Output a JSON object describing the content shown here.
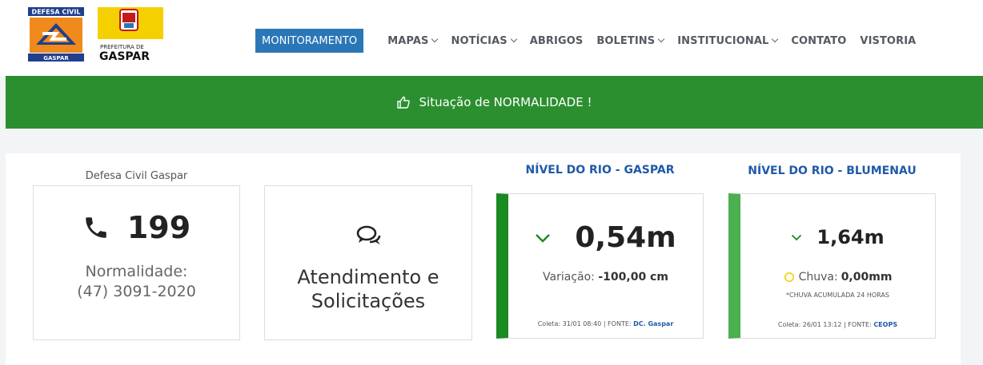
{
  "header": {
    "logo_dc": {
      "line1": "DEFESA CIVIL",
      "line2": "GASPAR"
    },
    "logo_pref": {
      "line1": "PREFEITURA DE",
      "line2": "GASPAR"
    },
    "nav": [
      {
        "label": "MONITORAMENTO",
        "dropdown": false,
        "active": true
      },
      {
        "label": "MAPAS",
        "dropdown": true
      },
      {
        "label": "NOTÍCIAS",
        "dropdown": true
      },
      {
        "label": "ABRIGOS",
        "dropdown": false
      },
      {
        "label": "BOLETINS",
        "dropdown": true
      },
      {
        "label": "INSTITUCIONAL",
        "dropdown": true
      },
      {
        "label": "CONTATO",
        "dropdown": false
      },
      {
        "label": "VISTORIA",
        "dropdown": false
      }
    ]
  },
  "banner": {
    "icon": "thumbs-up-icon",
    "text": "Situação de NORMALIDADE !",
    "color": "#2b8f2f"
  },
  "contact": {
    "label": "Defesa Civil Gaspar",
    "phone": "199",
    "normal_label": "Normalidade:",
    "normal_phone": "(47) 3091-2020"
  },
  "atendimento": {
    "line1": "Atendimento e",
    "line2": "Solicitações"
  },
  "rio_gaspar": {
    "title": "NÍVEL DO RIO - GASPAR",
    "level": "0,54m",
    "variacao_label": "Variação:",
    "variacao_value": "-100,00 cm",
    "coleta": "Coleta: 31/01 08:40 | FONTE:",
    "fonte": "DC. Gaspar",
    "accent": "#1a8a23"
  },
  "rio_blumenau": {
    "title": "NÍVEL DO RIO - BLUMENAU",
    "level": "1,64m",
    "chuva_label": "Chuva:",
    "chuva_value": "0,00mm",
    "acumulada": "*CHUVA ACUMULADA 24 HORAS",
    "coleta": "Coleta: 26/01 13:12 | FONTE:",
    "fonte": "CEOPS",
    "accent": "#4caf50"
  }
}
